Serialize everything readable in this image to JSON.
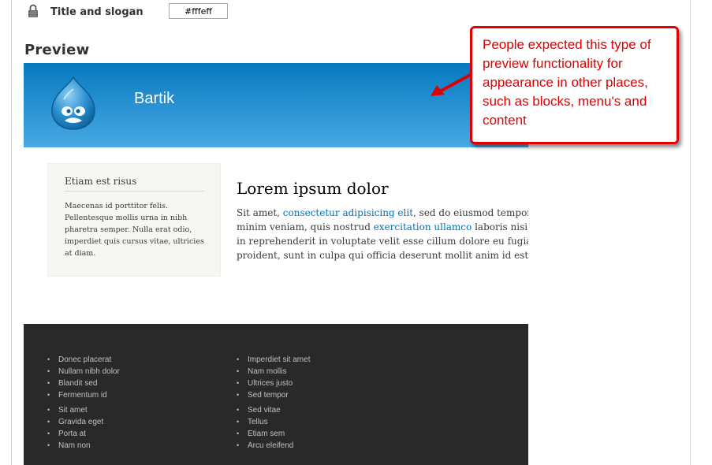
{
  "settings": {
    "field_label": "Title and slogan",
    "color_value": "#fffeff",
    "lock_icon": "lock-icon"
  },
  "preview": {
    "heading": "Preview",
    "header": {
      "site_name": "Bartik",
      "logo_icon": "drupal-drop-icon",
      "colors": {
        "gradient_top": "#0779bf",
        "gradient_bottom": "#48a9e4"
      }
    },
    "sidebar": {
      "title": "Etiam est risus",
      "body": "Maecenas id porttitor felis. Pellentesque mollis urna in nibh pharetra semper. Nulla erat odio, imperdiet quis cursus vitae, ultricies at diam."
    },
    "main": {
      "title": "Lorem ipsum dolor",
      "lines": [
        {
          "before": "Sit amet, ",
          "link": "consectetur adipisicing elit",
          "after": ", sed do eiusmod tempor inc"
        },
        {
          "before": "minim veniam, quis nostrud ",
          "link": "exercitation ullamco",
          "after": " laboris nisi ut"
        },
        {
          "text": "in reprehenderit in voluptate velit esse cillum dolore eu fugiat n"
        },
        {
          "text": "proident, sunt in culpa qui officia deserunt mollit anim id est lab"
        }
      ],
      "link_color": "#0071b3"
    },
    "footer": {
      "left_column": [
        "Donec placerat",
        "Nullam nibh dolor",
        "Blandit sed",
        "Fermentum id",
        "Sit amet",
        "Gravida eget",
        "Porta at",
        "Nam non"
      ],
      "right_column": [
        "Imperdiet sit amet",
        "Nam mollis",
        "Ultrices justo",
        "Sed tempor",
        "Sed vitae",
        "Tellus",
        "Etiam sem",
        "Arcu eleifend"
      ],
      "background": "#292929"
    }
  },
  "callout": {
    "text": "People expected this type of preview functionality for appearance in other places, such as blocks, menu's and content",
    "color": "#e00000"
  }
}
